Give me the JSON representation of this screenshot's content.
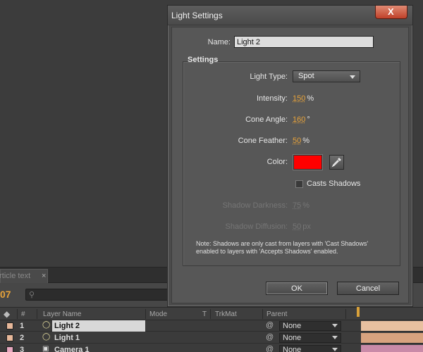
{
  "background": {
    "tab_label": "article text",
    "tab_close": "×",
    "timecode": "07",
    "columns": {
      "hash": "#",
      "layer_name": "Layer Name",
      "mode": "Mode",
      "t": "T",
      "trkmat": "TrkMat",
      "parent": "Parent"
    },
    "layers": [
      {
        "num": "1",
        "name": "Light 2",
        "parent": "None",
        "color": "#e7b89a",
        "bar": "#e8c0a0",
        "selected": true
      },
      {
        "num": "2",
        "name": "Light 1",
        "parent": "None",
        "color": "#e7b89a",
        "bar": "#d8a37f",
        "selected": false
      },
      {
        "num": "3",
        "name": "Camera 1",
        "parent": "None",
        "color": "#e8a8c0",
        "bar": "#c98aa8",
        "selected": false
      }
    ]
  },
  "dialog": {
    "title": "Light Settings",
    "close": "X",
    "name_label": "Name:",
    "name_value": "Light 2",
    "group_title": "Settings",
    "light_type_label": "Light Type:",
    "light_type_value": "Spot",
    "intensity_label": "Intensity:",
    "intensity_value": "150",
    "intensity_unit": "%",
    "cone_angle_label": "Cone Angle:",
    "cone_angle_value": "160",
    "cone_angle_unit": "°",
    "cone_feather_label": "Cone Feather:",
    "cone_feather_value": "50",
    "cone_feather_unit": "%",
    "color_label": "Color:",
    "color_value": "#ff0000",
    "casts_shadows_label": "Casts Shadows",
    "casts_shadows_checked": false,
    "shadow_darkness_label": "Shadow Darkness:",
    "shadow_darkness_value": "75",
    "shadow_darkness_unit": "%",
    "shadow_diffusion_label": "Shadow Diffusion:",
    "shadow_diffusion_value": "50",
    "shadow_diffusion_unit": "px",
    "note": "Note: Shadows are only cast from layers with 'Cast Shadows' enabled to layers with 'Accepts Shadows' enabled.",
    "ok_label": "OK",
    "cancel_label": "Cancel"
  }
}
